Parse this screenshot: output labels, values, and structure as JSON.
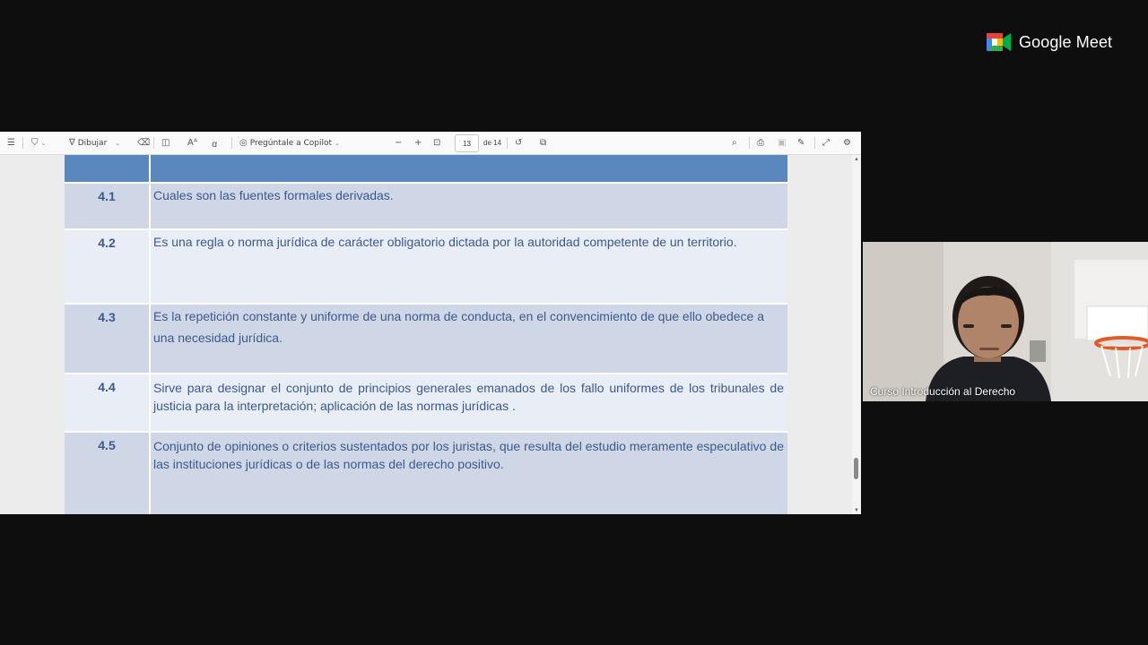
{
  "viewer": {
    "toolbar": {
      "draw_label": "Dibujar",
      "copilot_label": "Pregúntale a Copilot",
      "page_current": "13",
      "page_total_label": "de 14"
    },
    "table": {
      "rows": [
        {
          "num": "4.1",
          "text": "Cuales son las fuentes formales derivadas."
        },
        {
          "num": "4.2",
          "text": "Es una regla o norma jurídica de carácter obligatorio dictada por la autoridad competente de un territorio."
        },
        {
          "num": "4.3",
          "text": "Es la repetición constante y uniforme de una norma de conducta, en el convencimiento de que ello obedece a una necesidad jurídica."
        },
        {
          "num": "4.4",
          "text": "Sirve para designar el conjunto de principios generales emanados de los fallo uniformes de los tribunales de justicia para la interpretación; aplicación de las normas jurídicas ."
        },
        {
          "num": "4.5",
          "text": "Conjunto de opiniones o criterios sustentados por los juristas, que resulta del estudio meramente especulativo de las instituciones jurídicas o de las normas del derecho positivo."
        }
      ]
    }
  },
  "meet": {
    "logo_text": "Google Meet",
    "participant_name": "Curso Introducción al Derecho"
  },
  "colors": {
    "table_header": "#5b87bf",
    "row_dark": "#cfd7e7",
    "row_light": "#e9edf5",
    "text": "#3a5a8c"
  }
}
